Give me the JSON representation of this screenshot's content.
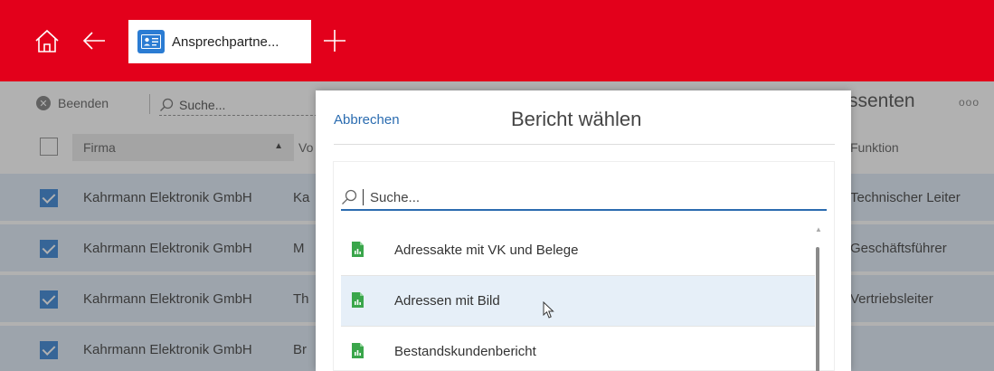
{
  "header": {
    "tab_label": "Ansprechpartne..."
  },
  "toolbar": {
    "exit_label": "Beenden",
    "search_placeholder": "Suche...",
    "right_label": "ssenten",
    "more_label": "ooo"
  },
  "table": {
    "columns": {
      "firma": "Firma",
      "vorname": "Vo",
      "funktion": "Funktion"
    },
    "rows": [
      {
        "checked": true,
        "firma": "Kahrmann Elektronik GmbH",
        "vo": "Ka",
        "funktion": "Technischer Leiter"
      },
      {
        "checked": true,
        "firma": "Kahrmann Elektronik GmbH",
        "vo": "M",
        "funktion": "Geschäftsführer"
      },
      {
        "checked": true,
        "firma": "Kahrmann Elektronik GmbH",
        "vo": "Th",
        "funktion": "Vertriebsleiter"
      },
      {
        "checked": true,
        "firma": "Kahrmann Elektronik GmbH",
        "vo": "Br",
        "funktion": ""
      }
    ]
  },
  "dialog": {
    "cancel_label": "Abbrechen",
    "title": "Bericht wählen",
    "search_placeholder": "Suche...",
    "items": [
      {
        "label": "Adressakte mit VK und Belege",
        "highlighted": false
      },
      {
        "label": "Adressen mit Bild",
        "highlighted": true
      },
      {
        "label": "Bestandskundenbericht",
        "highlighted": false
      }
    ]
  },
  "colors": {
    "brand_red": "#e3001b",
    "accent_blue": "#2b7cd3",
    "link_blue": "#2b6cb0",
    "row_selected": "#dde9f6",
    "item_highlight": "#e6eff8",
    "report_icon_green": "#3aa64b"
  },
  "icons": {
    "home": "home-icon",
    "back": "arrow-left-icon",
    "tab": "contact-card-icon",
    "new_tab": "plus-icon",
    "exit": "close-circle-icon",
    "search": "search-icon",
    "sort": "sort-ascending-icon",
    "report": "spreadsheet-report-icon",
    "cursor": "mouse-pointer-icon"
  }
}
